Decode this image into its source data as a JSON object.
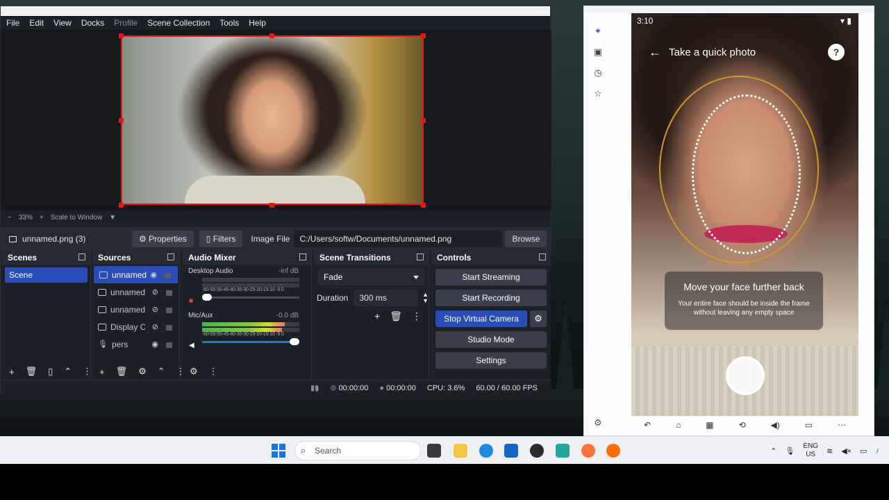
{
  "obs": {
    "menu": [
      {
        "label": "File",
        "dim": false
      },
      {
        "label": "Edit",
        "dim": false
      },
      {
        "label": "View",
        "dim": false
      },
      {
        "label": "Docks",
        "dim": false
      },
      {
        "label": "Profile",
        "dim": true
      },
      {
        "label": "Scene Collection",
        "dim": false
      },
      {
        "label": "Tools",
        "dim": false
      },
      {
        "label": "Help",
        "dim": false
      }
    ],
    "preview": {
      "zoom": "33%",
      "scale_mode": "Scale to Window",
      "selection_color": "#e01a1a"
    },
    "source_toolbar": {
      "source_name": "unnamed.png (3)",
      "properties": "Properties",
      "filters": "Filters",
      "image_file_label": "Image File",
      "path": "C:/Users/softw/Documents/unnamed.png",
      "browse": "Browse"
    },
    "scenes": {
      "title": "Scenes",
      "items": [
        "Scene"
      ]
    },
    "sources": {
      "title": "Sources",
      "items": [
        {
          "label": "unnamed",
          "type": "image",
          "visible": true,
          "selected": true
        },
        {
          "label": "unnamed",
          "type": "image",
          "visible": false,
          "selected": false
        },
        {
          "label": "unnamed",
          "type": "image",
          "visible": false,
          "selected": false
        },
        {
          "label": "Display Ca",
          "type": "display",
          "visible": false,
          "selected": false
        },
        {
          "label": "pers",
          "type": "mic",
          "visible": true,
          "selected": false
        }
      ]
    },
    "mixer": {
      "title": "Audio Mixer",
      "channels": [
        {
          "name": "Desktop Audio",
          "level": "-inf dB",
          "muted": true,
          "meter": 0.0
        },
        {
          "name": "Mic/Aux",
          "level": "-0.0 dB",
          "muted": false,
          "meter": 0.85
        }
      ],
      "scale": "-60-55-50-45-40-35-30-25-20-15-10 -5 0"
    },
    "transitions": {
      "title": "Scene Transitions",
      "selected": "Fade",
      "duration_label": "Duration",
      "duration_value": "300 ms"
    },
    "controls": {
      "title": "Controls",
      "start_streaming": "Start Streaming",
      "start_recording": "Start Recording",
      "stop_virtual_camera": "Stop Virtual Camera",
      "studio_mode": "Studio Mode",
      "settings": "Settings",
      "accent": "#284cb8"
    },
    "status": {
      "stream_time": "00:00:00",
      "record_time": "00:00:00",
      "cpu": "CPU: 3.6%",
      "fps": "60.00 / 60.00 FPS"
    }
  },
  "phone": {
    "status_time": "3:10",
    "header_title": "Take a quick photo",
    "help_label": "?",
    "message": "Move your face further back",
    "sub_message": "Your entire face should be inside the frame without leaving any empty space",
    "guide_color": "#d19a2a"
  },
  "taskbar": {
    "search_placeholder": "Search",
    "lang_top": "ENG",
    "lang_bottom": "US"
  }
}
